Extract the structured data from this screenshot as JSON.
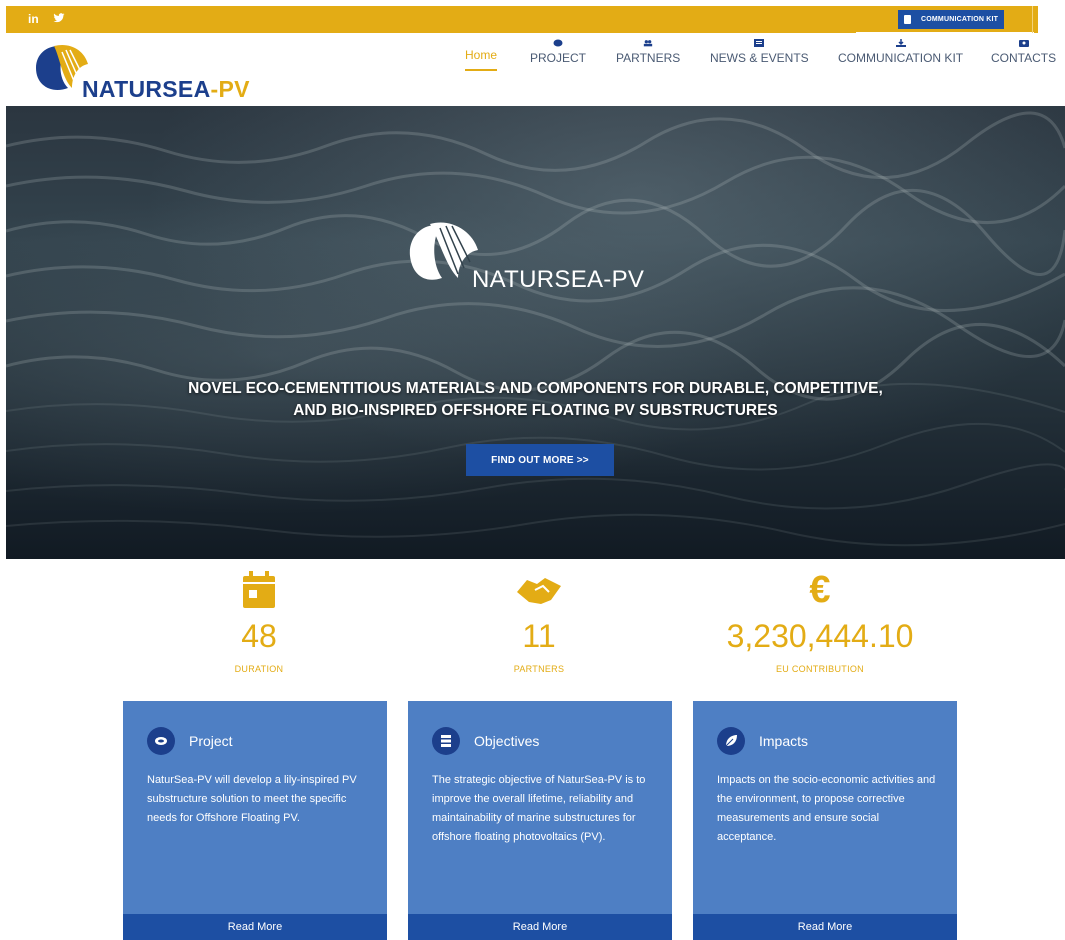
{
  "topbar": {
    "social": [
      "in"
    ],
    "communication_kit_label": "COMMUNICATION KIT"
  },
  "brand": {
    "name": "NATURSEA",
    "suffix": "-PV",
    "hero_name": "NATURSEA-PV"
  },
  "nav": {
    "home": "Home",
    "items": [
      "PROJECT",
      "PARTNERS",
      "NEWS & EVENTS",
      "COMMUNICATION KIT",
      "CONTACTS"
    ]
  },
  "hero": {
    "tagline_line1": "NOVEL ECO-CEMENTITIOUS MATERIALS AND COMPONENTS FOR DURABLE, COMPETITIVE,",
    "tagline_line2": "AND BIO-INSPIRED OFFSHORE FLOATING PV SUBSTRUCTURES",
    "cta": "FIND OUT MORE >>"
  },
  "stats": [
    {
      "value": "48",
      "label": "DURATION",
      "icon": "calendar-icon"
    },
    {
      "value": "11",
      "label": "PARTNERS",
      "icon": "handshake-icon"
    },
    {
      "value": "3,230,444.10",
      "label": "EU CONTRIBUTION",
      "icon": "euro-icon",
      "symbol": "€"
    }
  ],
  "cards": [
    {
      "title": "Project",
      "body": "NaturSea-PV will develop a lily-inspired PV substructure solution to meet the specific needs for Offshore Floating PV.",
      "link": "Read More"
    },
    {
      "title": "Objectives",
      "body": "The strategic objective of NaturSea-PV is to improve the overall lifetime, reliability and maintainability of marine substructures for offshore floating photovoltaics (PV).",
      "link": "Read More"
    },
    {
      "title": "Impacts",
      "body": "Impacts on the socio-economic activities and the environment, to propose corrective measurements and ensure social acceptance.",
      "link": "Read More"
    }
  ],
  "colors": {
    "gold": "#e3ac15",
    "navy": "#1c3f8c",
    "blue_button": "#1d4fa3",
    "card_blue": "#4e7fc4"
  }
}
